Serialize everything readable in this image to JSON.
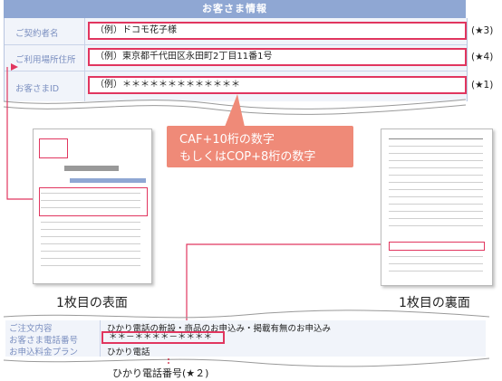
{
  "info": {
    "header": "お客さま情報",
    "rows": [
      {
        "label": "ご契約者名",
        "value": "（例）ドコモ花子様",
        "note": "(★3)"
      },
      {
        "label": "ご利用場所住所",
        "value": "（例）東京都千代田区永田町2丁目11番1号",
        "note": "(★4)"
      },
      {
        "label": "お客さまID",
        "value": "（例）＊＊＊＊＊＊＊＊＊＊＊＊＊",
        "note": "(★1)"
      }
    ]
  },
  "callout": {
    "line1": "CAF+10桁の数字",
    "line2": "もしくはCOP+8桁の数字"
  },
  "captions": {
    "front": "1枚目の表面",
    "back": "1枚目の裏面"
  },
  "order": {
    "rows": [
      {
        "label": "ご注文内容",
        "value": "ひかり電話の新設・商品のお申込み・掲載有無のお申込み"
      },
      {
        "label": "お客さま電話番号",
        "value": "＊＊－＊＊＊＊－＊＊＊＊"
      },
      {
        "label": "お申込料金プラン",
        "value": "ひかり電話"
      }
    ],
    "annotation": "ひかり電話番号(★２)"
  },
  "colors": {
    "accent": "#e1365f",
    "header_bg": "#8fa7d3",
    "callout_bg": "#ef8a78"
  }
}
